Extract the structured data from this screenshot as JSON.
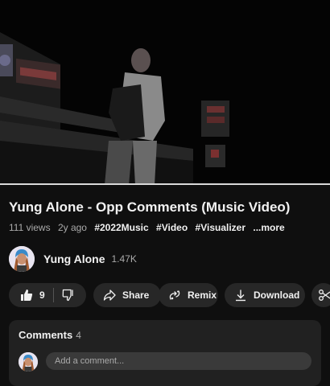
{
  "video": {
    "progress_fraction": 1.0
  },
  "title": "Yung Alone - Opp Comments (Music Video)",
  "meta": {
    "views": "111 views",
    "age": "2y ago",
    "tags": [
      "#2022Music",
      "#Video",
      "#Visualizer"
    ],
    "more": "...more"
  },
  "channel": {
    "name": "Yung Alone",
    "subscribers": "1.47K"
  },
  "actions": {
    "likes": "9",
    "share": "Share",
    "remix": "Remix",
    "download": "Download",
    "clip_icon": "scissors-icon"
  },
  "comments": {
    "header": "Comments",
    "count": "4",
    "placeholder": "Add a comment..."
  },
  "colors": {
    "background": "#0f0f0f",
    "surface": "#272727",
    "comments_surface": "#212121",
    "text": "#f1f1f1",
    "muted": "#aaaaaa"
  }
}
